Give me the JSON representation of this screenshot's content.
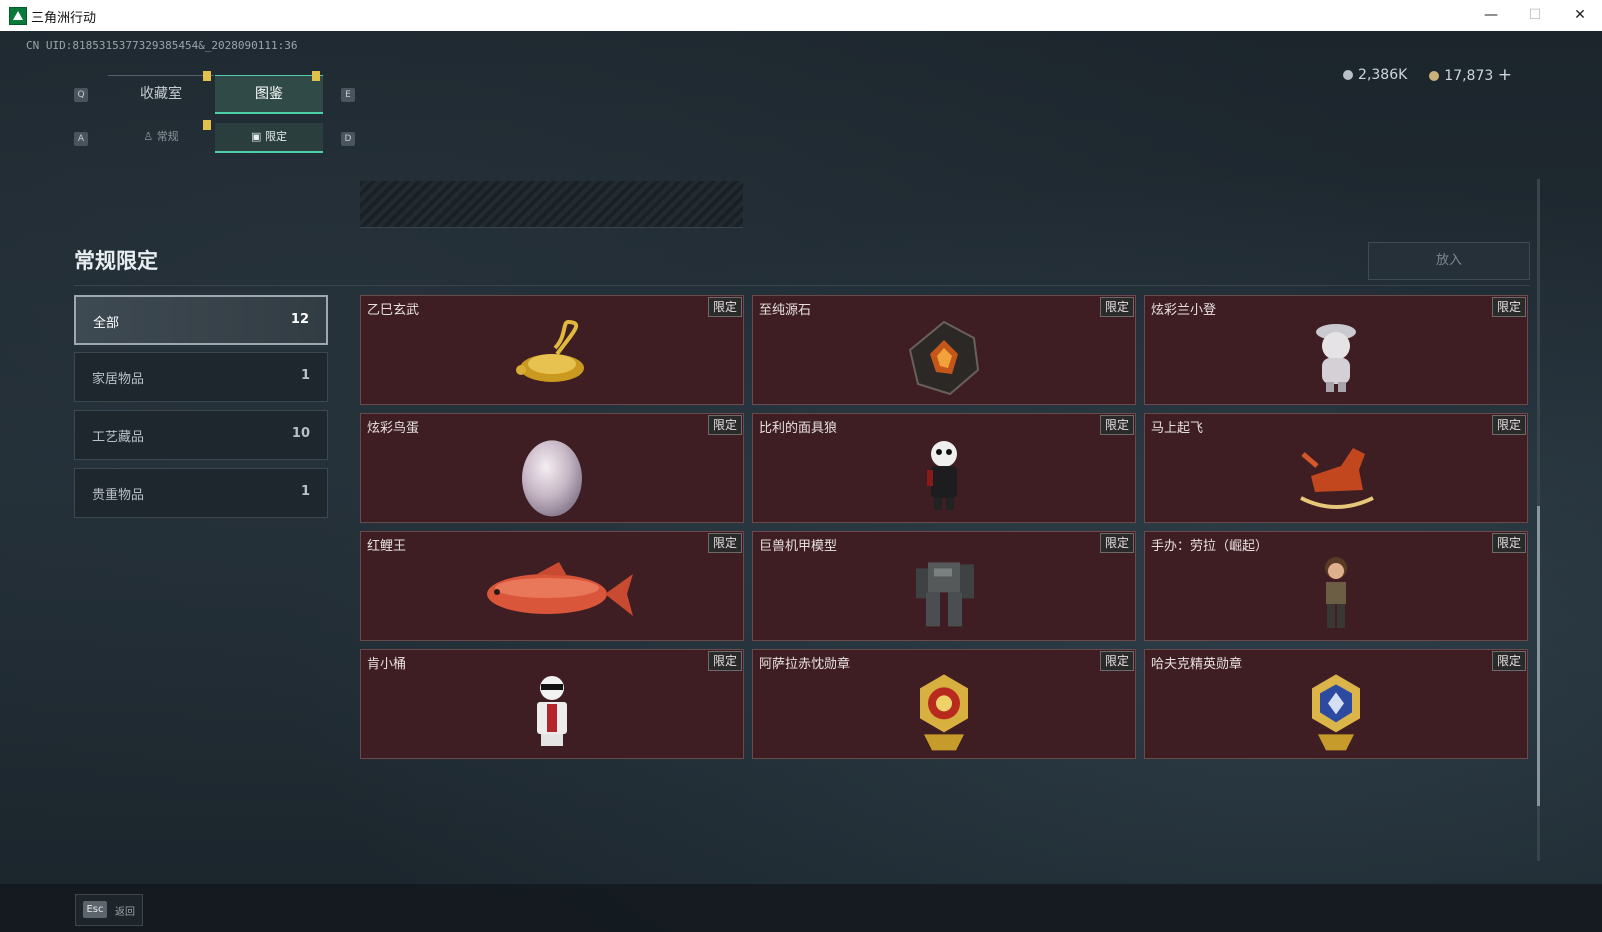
{
  "window": {
    "title": "三角洲行动",
    "minimize": "—",
    "maximize": "☐",
    "close": "✕"
  },
  "uid": "CN UID:8185315377329385454&_2028090111:36",
  "currency": {
    "silver": "2,386K",
    "gold": "17,873",
    "add": "+"
  },
  "keys": {
    "q": "Q",
    "e": "E",
    "a": "A",
    "d": "D"
  },
  "tabs": [
    {
      "label": "收藏室"
    },
    {
      "label": "图鉴"
    }
  ],
  "subtabs": [
    {
      "label": "常规",
      "icon": "figure-icon"
    },
    {
      "label": "限定",
      "icon": "image-icon"
    }
  ],
  "section_title": "常规限定",
  "put_button": "放入",
  "categories": [
    {
      "label": "全部",
      "count": "12"
    },
    {
      "label": "家居物品",
      "count": "1"
    },
    {
      "label": "工艺藏品",
      "count": "10"
    },
    {
      "label": "贵重物品",
      "count": "1"
    }
  ],
  "items": [
    {
      "name": "乙巳玄武",
      "tag": "限定",
      "icon": "gold-turtle-snake-icon"
    },
    {
      "name": "至纯源石",
      "tag": "限定",
      "icon": "glowing-stone-icon"
    },
    {
      "name": "炫彩兰小登",
      "tag": "限定",
      "icon": "figure-doll-icon"
    },
    {
      "name": "炫彩鸟蛋",
      "tag": "限定",
      "icon": "pearl-egg-icon"
    },
    {
      "name": "比利的面具狼",
      "tag": "限定",
      "icon": "masked-figure-icon"
    },
    {
      "name": "马上起飞",
      "tag": "限定",
      "icon": "rocking-horse-icon"
    },
    {
      "name": "红鲤王",
      "tag": "限定",
      "icon": "red-carp-icon"
    },
    {
      "name": "巨兽机甲模型",
      "tag": "限定",
      "icon": "mech-model-icon"
    },
    {
      "name": "手办：劳拉（崛起）",
      "tag": "限定",
      "icon": "lara-figure-icon"
    },
    {
      "name": "肯小桶",
      "tag": "限定",
      "icon": "bucket-mascot-icon"
    },
    {
      "name": "阿萨拉赤忱勋章",
      "tag": "限定",
      "icon": "red-gold-medal-icon"
    },
    {
      "name": "哈夫克精英勋章",
      "tag": "限定",
      "icon": "blue-gold-medal-icon"
    }
  ],
  "footer": {
    "esc_key": "Esc",
    "esc_label": "返回"
  }
}
